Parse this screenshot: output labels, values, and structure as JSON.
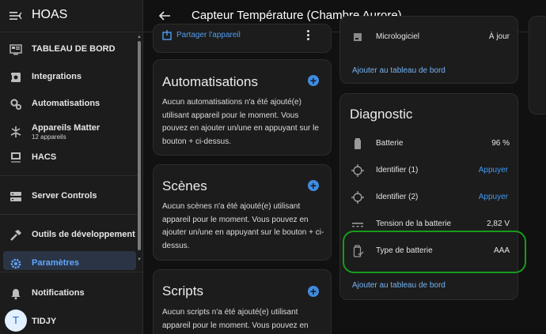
{
  "app": {
    "title": "HOAS"
  },
  "header": {
    "title": "Capteur Température (Chambre Aurore)"
  },
  "sidebar": {
    "items": [
      {
        "label": "TABLEAU DE BORD",
        "sub": ""
      },
      {
        "label": "Integrations",
        "sub": ""
      },
      {
        "label": "Automatisations",
        "sub": ""
      },
      {
        "label": "Appareils Matter",
        "sub": "12 appareils"
      },
      {
        "label": "HACS",
        "sub": ""
      },
      {
        "label": "Server Controls",
        "sub": ""
      },
      {
        "label": "Outils de développement",
        "sub": ""
      },
      {
        "label": "Paramètres",
        "sub": ""
      }
    ],
    "notifications": "Notifications",
    "user": {
      "name": "TIDJY",
      "initial": "T"
    }
  },
  "left_column": {
    "share_label": "Partager l'appareil",
    "automations": {
      "title": "Automatisations",
      "text": "Aucun automatisations n'a été ajouté(e) utilisant appareil pour le moment. Vous pouvez en ajouter un/une en appuyant sur le bouton + ci-dessus."
    },
    "scenes": {
      "title": "Scènes",
      "text": "Aucun scènes n'a été ajouté(e) utilisant appareil pour le moment. Vous pouvez en ajouter un/une en appuyant sur le bouton + ci-dessus."
    },
    "scripts": {
      "title": "Scripts",
      "text": "Aucun scripts n'a été ajouté(e) utilisant appareil pour le moment. Vous pouvez en"
    }
  },
  "right_column": {
    "firmware": {
      "label": "Micrologiciel",
      "value": "À jour"
    },
    "add_to_dashboard_1": "Ajouter au tableau de bord",
    "diagnostic": {
      "title": "Diagnostic",
      "rows": [
        {
          "label": "Batterie",
          "value": "96 %"
        },
        {
          "label": "Identifier (1)",
          "button": "Appuyer"
        },
        {
          "label": "Identifier (2)",
          "button": "Appuyer"
        },
        {
          "label": "Tension de la batterie",
          "value": "2,82 V"
        },
        {
          "label": "Type de batterie",
          "value": "AAA"
        }
      ],
      "add_to_dashboard": "Ajouter au tableau de bord"
    }
  },
  "colors": {
    "accent": "#3f8be0",
    "link": "#74b4f4",
    "highlight": "#169b1c",
    "active_nav": "#5fa8ff"
  }
}
